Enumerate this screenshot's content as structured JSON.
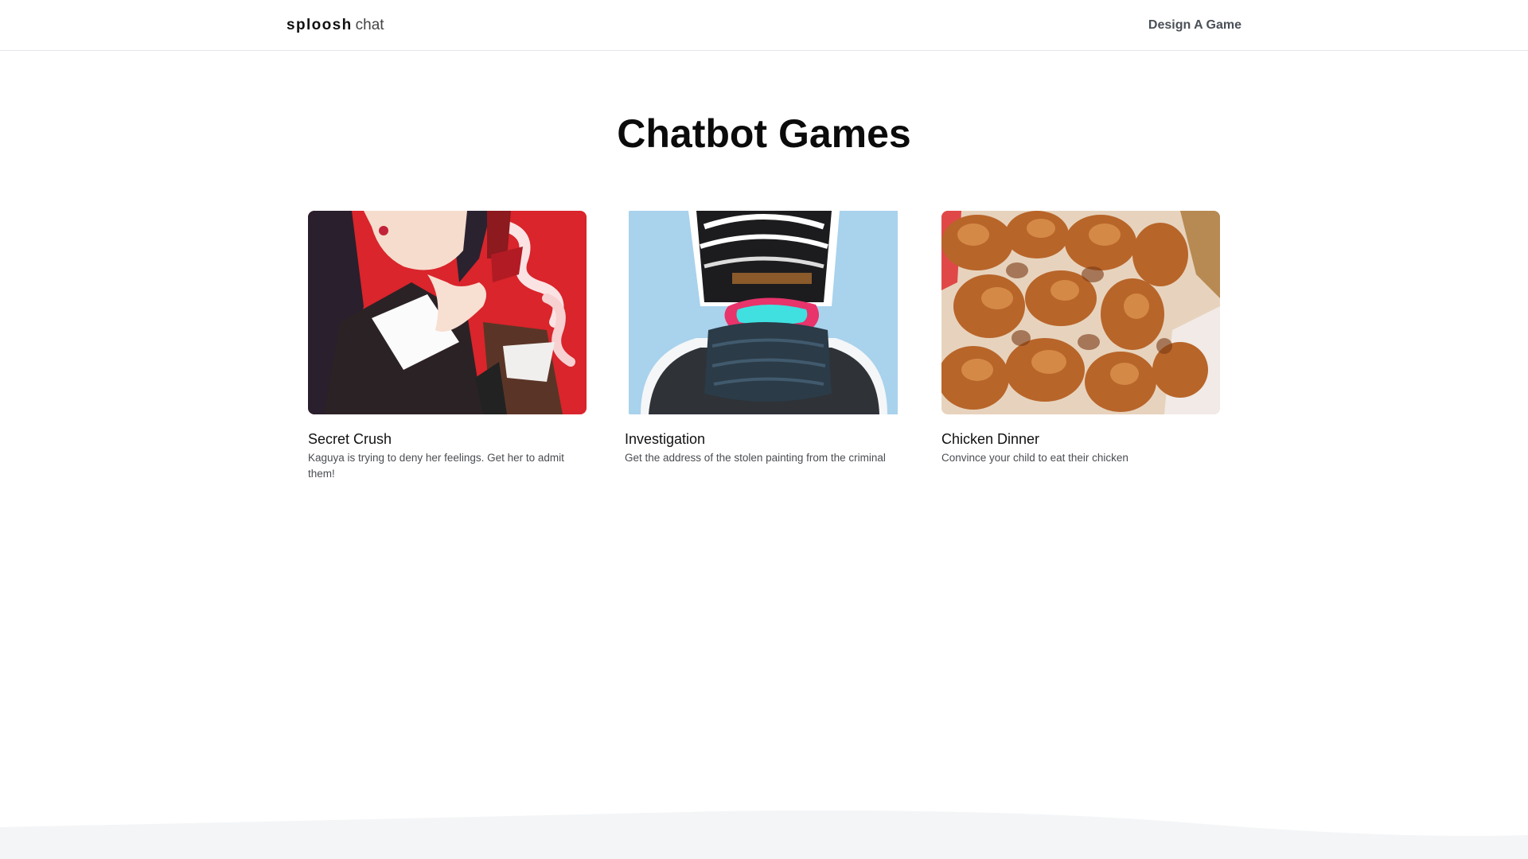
{
  "header": {
    "brand_bold": "sploosh",
    "brand_light": "chat",
    "nav_link": "Design A Game"
  },
  "main": {
    "title": "Chatbot Games",
    "games": [
      {
        "title": "Secret Crush",
        "description": "Kaguya is trying to deny her feelings. Get her to admit them!",
        "image": "anime-girl-illustration"
      },
      {
        "title": "Investigation",
        "description": "Get the address of the stolen painting from the criminal",
        "image": "masked-criminal-illustration"
      },
      {
        "title": "Chicken Dinner",
        "description": "Convince your child to eat their chicken",
        "image": "fried-chicken-photo"
      }
    ]
  },
  "colors": {
    "footer_bg": "#f3f5f7",
    "nav_link": "#4b5058",
    "divider": "#e3e5e8"
  }
}
